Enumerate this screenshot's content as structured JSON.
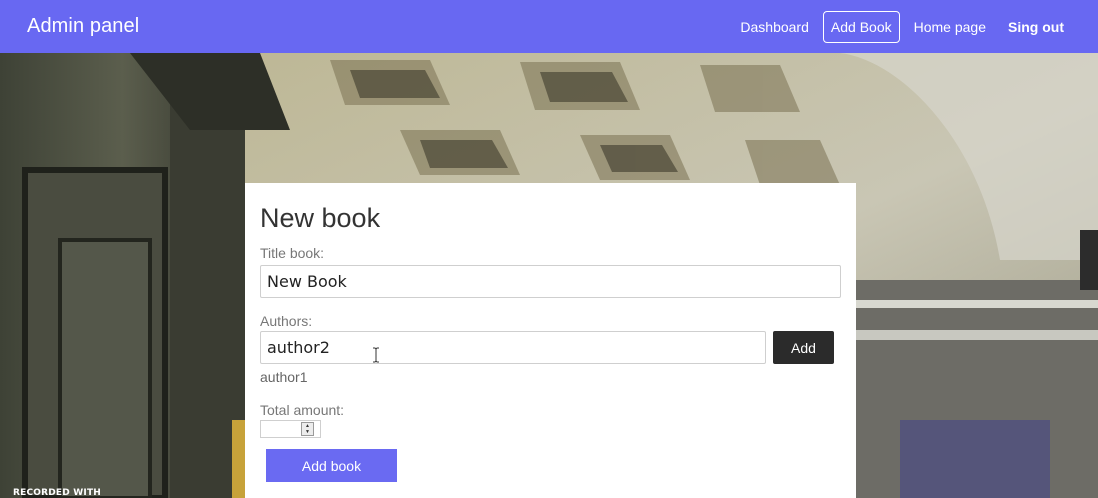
{
  "navbar": {
    "brand": "Admin panel",
    "links": [
      {
        "label": "Dashboard"
      },
      {
        "label": "Add Book"
      },
      {
        "label": "Home page"
      },
      {
        "label": "Sing out"
      }
    ],
    "color": "#6868f2"
  },
  "form": {
    "title": "New book",
    "title_label": "Title book:",
    "title_value": "New Book",
    "authors_label": "Authors:",
    "authors_value": "author2",
    "add_author_label": "Add",
    "authors_list": [
      "author1"
    ],
    "amount_label": "Total amount:",
    "amount_value": "",
    "submit_label": "Add book"
  },
  "overlay": {
    "watermark": "RECORDED WITH"
  },
  "colors": {
    "accent": "#6868f2",
    "dark_button": "#2b2b2b"
  }
}
